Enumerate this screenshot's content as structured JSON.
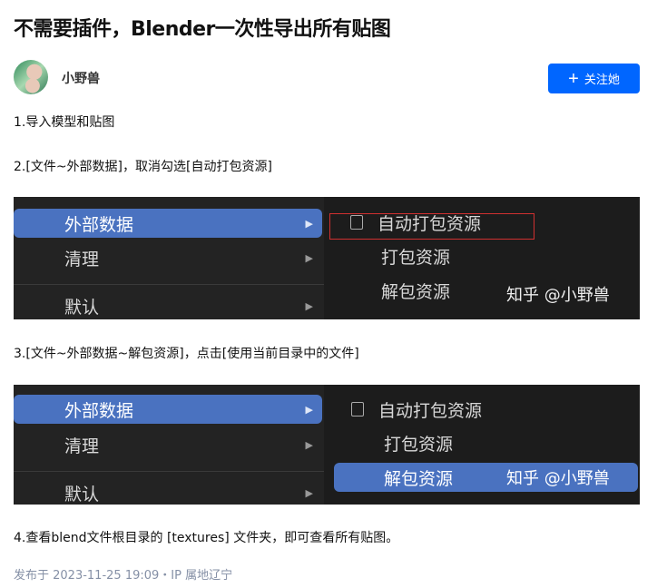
{
  "title": "不需要插件，Blender一次性导出所有贴图",
  "author": {
    "name": "小野兽",
    "follow_label": "关注她",
    "follow_icon": "plus-icon"
  },
  "paragraphs": [
    "1.导入模型和贴图",
    "2.[文件~外部数据]，取消勾选[自动打包资源]",
    "3.[文件~外部数据~解包资源]，点击[使用当前目录中的文件]",
    "4.查看blend文件根目录的 [textures] 文件夹，即可查看所有贴图。"
  ],
  "screenshot1": {
    "menu": [
      "外部数据",
      "清理",
      "默认"
    ],
    "submenu": [
      "自动打包资源",
      "打包资源",
      "解包资源"
    ],
    "watermark": "知乎 @小野兽"
  },
  "screenshot2": {
    "menu": [
      "外部数据",
      "清理",
      "默认"
    ],
    "submenu": [
      "自动打包资源",
      "打包资源",
      "解包资源"
    ],
    "watermark": "知乎 @小野兽"
  },
  "footer": "发布于 2023-11-25 19:09・IP 属地辽宁",
  "colors": {
    "accent": "#0066ff",
    "menu_highlight": "#4a72c0",
    "annotation": "#d03030"
  }
}
